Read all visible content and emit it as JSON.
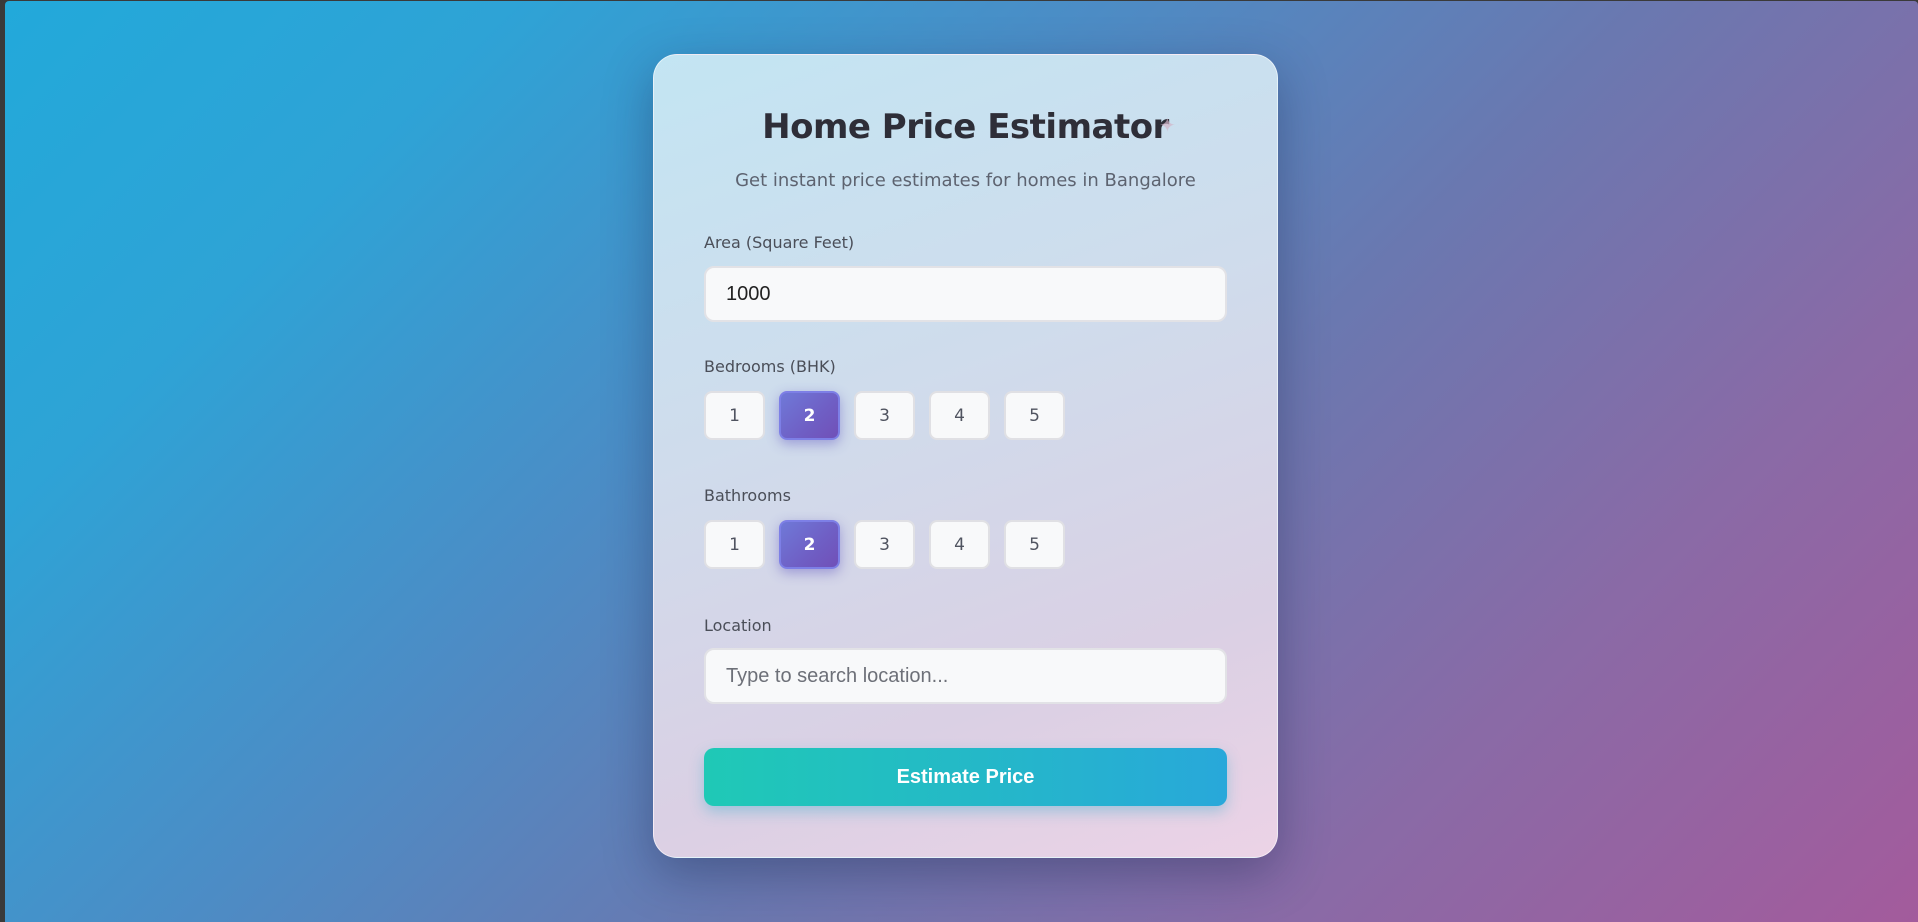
{
  "header": {
    "title": "Home Price Estimator",
    "subtitle": "Get instant price estimates for homes in Bangalore",
    "sparkle_icon": "sparkle-icon"
  },
  "form": {
    "area": {
      "label": "Area (Square Feet)",
      "value": "1000"
    },
    "bedrooms": {
      "label": "Bedrooms (BHK)",
      "options": [
        "1",
        "2",
        "3",
        "4",
        "5"
      ],
      "selected": "2"
    },
    "bathrooms": {
      "label": "Bathrooms",
      "options": [
        "1",
        "2",
        "3",
        "4",
        "5"
      ],
      "selected": "2"
    },
    "location": {
      "label": "Location",
      "value": "",
      "placeholder": "Type to search location..."
    },
    "submit_label": "Estimate Price"
  },
  "colors": {
    "accent_selected": "#6f5ec4",
    "button_gradient_start": "#1fc9b6",
    "button_gradient_end": "#28a8da"
  }
}
